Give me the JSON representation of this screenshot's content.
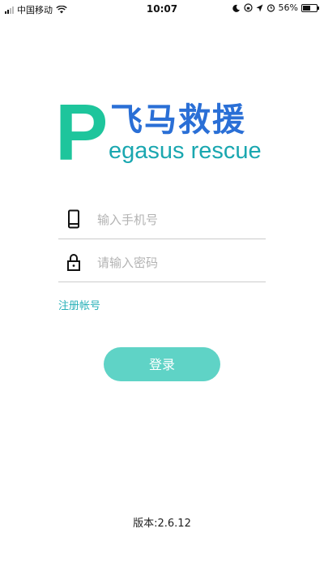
{
  "status_bar": {
    "carrier": "中国移动",
    "time": "10:07",
    "battery_percent": "56%",
    "battery_level": 0.56,
    "icons": [
      "signal-icon",
      "wifi-icon",
      "moon-icon",
      "lock-rotation-icon",
      "location-icon",
      "alarm-icon",
      "battery-icon"
    ]
  },
  "logo": {
    "cn": "飞马救援",
    "p_letter": "P",
    "en": "egasus rescue",
    "colors": {
      "p": "#1ec59c",
      "cn": "#2a6fd6",
      "en": "#1aa7b0"
    }
  },
  "form": {
    "phone_placeholder": "输入手机号",
    "phone_value": "",
    "password_placeholder": "请输入密码",
    "password_value": ""
  },
  "register_label": "注册帐号",
  "login_label": "登录",
  "version_text": "版本:2.6.12",
  "colors": {
    "accent": "#5fd3c6",
    "link": "#28b0b8"
  }
}
